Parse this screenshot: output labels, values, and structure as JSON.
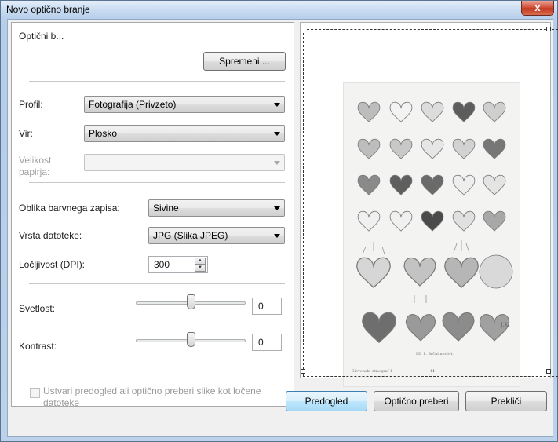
{
  "window": {
    "title": "Novo optično branje",
    "close_label": "x"
  },
  "scanner": {
    "label": "Optični b...",
    "change_button": "Spremeni ..."
  },
  "profile": {
    "label": "Profil:",
    "value": "Fotografija (Privzeto)"
  },
  "source": {
    "label": "Vir:",
    "value": "Plosko"
  },
  "paper_size": {
    "label": "Velikost papirja:",
    "value": ""
  },
  "color_format": {
    "label": "Oblika barvnega zapisa:",
    "value": "Sivine"
  },
  "file_type": {
    "label": "Vrsta datoteke:",
    "value": "JPG (Slika JPEG)"
  },
  "resolution": {
    "label": "Ločljivost (DPI):",
    "value": "300"
  },
  "brightness": {
    "label": "Svetlost:",
    "value": "0",
    "level": 0
  },
  "contrast": {
    "label": "Kontrast:",
    "value": "0",
    "level": 0
  },
  "separate_files": {
    "label": "Ustvari predogled ali optično preberi slike kot ločene datoteke",
    "checked": false
  },
  "preview": {
    "caption": "III. 1. Srčni motivi.",
    "footer_left": "Slovenski etnograf 1",
    "page_number": "41",
    "signature": "J.K."
  },
  "buttons": {
    "preview": "Predogled",
    "scan": "Optično preberi",
    "cancel": "Prekliči"
  },
  "colors": {
    "title_gradient": "#c9dcf1",
    "close_red": "#c23a22",
    "focus_blue": "#3c7fb1",
    "panel_bg": "#f0f0f0"
  }
}
